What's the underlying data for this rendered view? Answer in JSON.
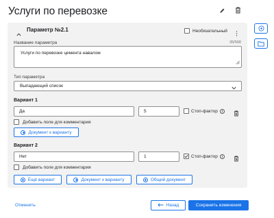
{
  "page": {
    "title": "Услуги по перевозке",
    "edit_icon": "pencil-icon",
    "delete_icon": "trash-icon"
  },
  "side": {
    "add_icon": "plus-circle-icon",
    "folder_icon": "folder-icon"
  },
  "parameter": {
    "title": "Параметр №2.1",
    "optional_label": "Необязательный",
    "optional_checked": false,
    "name_label": "Название параметра",
    "name_counter": "35/500",
    "name_value": "Услуги по перевозке цемента навалом",
    "type_label": "Тип параметра",
    "type_value": "Выпадающий список"
  },
  "variants": [
    {
      "title": "Вариант 1",
      "value": "Да",
      "score": "5",
      "stop_label": "Стоп-фактор",
      "stop_checked": false,
      "comment_label": "Добавить поле для комментария",
      "comment_checked": false,
      "doc_button": "Документ к варианту"
    },
    {
      "title": "Вариант 2",
      "value": "Нет",
      "score": "1",
      "stop_label": "Стоп-фактор",
      "stop_checked": true,
      "comment_label": "Добавить поле для комментария",
      "comment_checked": false
    }
  ],
  "actions": {
    "add_variant": "Ещё вариант",
    "variant_doc": "Документ к варианту",
    "common_doc": "Общий документ"
  },
  "footer": {
    "cancel": "Отменить",
    "back": "Назад",
    "save": "Сохранить изменения"
  },
  "colors": {
    "accent": "#1a73e8",
    "card_bg": "#f2f2f2"
  }
}
